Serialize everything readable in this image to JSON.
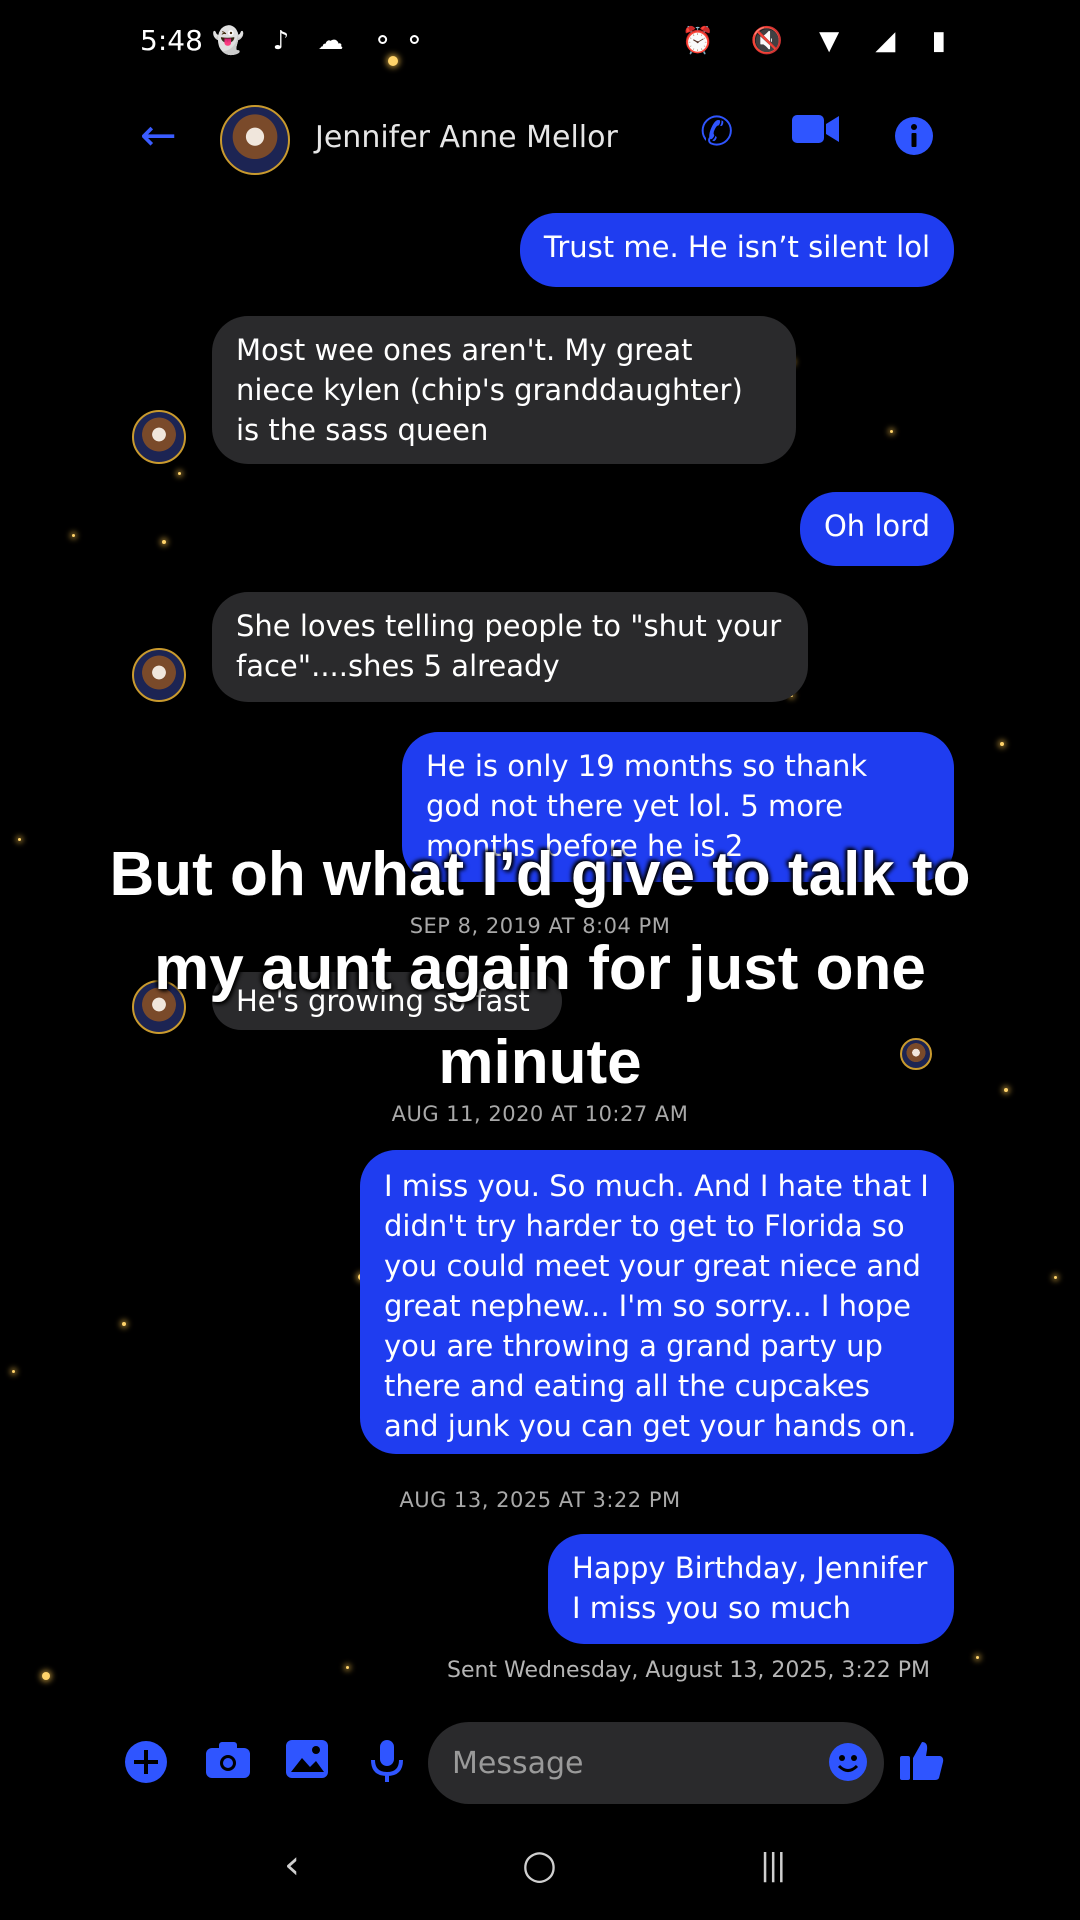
{
  "status_bar": {
    "time": "5:48",
    "left_icons": "👻 ♪ ☁ ⚬⚬",
    "right_icons": "⏰ 🔇 ▼ ◢ ▮"
  },
  "header": {
    "contact_name": "Jennifer Anne Mellor",
    "back_icon": "←",
    "call_icon": "✆",
    "video_icon": "■",
    "info_icon": "ⓘ"
  },
  "messages": [
    {
      "text": "Trust me. He isn’t silent lol"
    },
    {
      "text": "Most wee ones aren't.  My great niece kylen (chip's granddaughter) is the sass queen"
    },
    {
      "text": "Oh lord"
    },
    {
      "text": "She loves telling people to \"shut your face\"....shes 5 already"
    },
    {
      "text": "He is only 19 months so thank god not there yet lol. 5 more months before he is 2"
    },
    {
      "text": "He's growing so fast"
    },
    {
      "text": "I miss you. So much. And I hate that I didn't try harder to get to Florida so you could meet your great niece and great nephew... I'm so sorry... I hope you are throwing a grand party up there and eating all the cupcakes and junk you can get your hands on."
    },
    {
      "text": "Happy Birthday, Jennifer I miss you so much"
    }
  ],
  "timestamps": [
    "SEP 8, 2019 AT 8:04 PM",
    "AUG 11, 2020 AT 10:27 AM",
    "AUG 13, 2025 AT 3:22 PM"
  ],
  "sent_status": "Sent Wednesday, August 13, 2025, 3:22 PM",
  "caption": "But oh what I’d give to talk to my aunt again for just one minute",
  "composer": {
    "placeholder": "Message",
    "add_icon": "⊕",
    "camera_icon": "📷",
    "gallery_icon": "▣",
    "mic_icon": "🎙",
    "emoji_icon": "☺",
    "like_icon": "👍"
  },
  "navbar": {
    "back": "‹",
    "home": "○",
    "recents": "|||"
  },
  "colors": {
    "accent": "#2f55ff",
    "outgoing_bubble": "#1f3df0",
    "incoming_bubble": "#2a2a2c",
    "background": "#000000"
  }
}
